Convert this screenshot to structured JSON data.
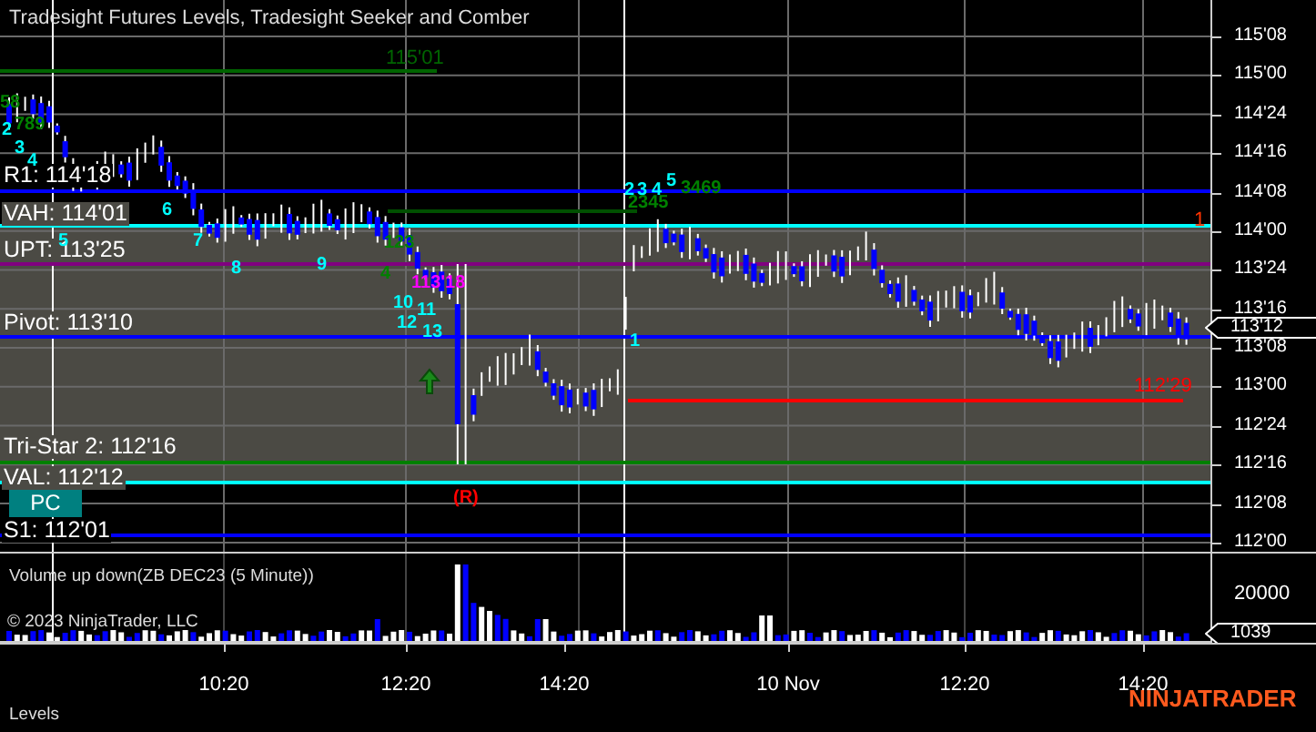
{
  "title": "Tradesight Futures Levels, Tradesight Seeker and Comber",
  "levels": [
    {
      "label": "R1: 114'18",
      "color": "#0000ff"
    },
    {
      "label": "VAH: 114'01",
      "color": "#00ffff"
    },
    {
      "label": "UPT: 113'25",
      "color": "#800080"
    },
    {
      "label": "Pivot: 113'10",
      "color": "#0000ff"
    },
    {
      "label": "Tri-Star 2: 112'16",
      "color": "#008000"
    },
    {
      "label": "VAL: 112'12",
      "color": "#00ffff"
    },
    {
      "label": "S1: 112'01",
      "color": "#0000ff"
    }
  ],
  "level_tags": [
    {
      "text": "115'01",
      "color": "#006400"
    },
    {
      "text": "112'29",
      "color": "#ff0000"
    },
    {
      "text": "1",
      "color": "#ff3300"
    }
  ],
  "markers": [
    {
      "text": "58",
      "color": "#008000"
    },
    {
      "text": "2",
      "color": "#00ffff"
    },
    {
      "text": "789",
      "color": "#008000"
    },
    {
      "text": "3",
      "color": "#00ffff"
    },
    {
      "text": "4",
      "color": "#00ffff"
    },
    {
      "text": "5",
      "color": "#00ffff"
    },
    {
      "text": "6",
      "color": "#00ffff"
    },
    {
      "text": "7",
      "color": "#00ffff"
    },
    {
      "text": "8",
      "color": "#00ffff"
    },
    {
      "text": "9",
      "color": "#00ffff"
    },
    {
      "text": "123",
      "color": "#008000"
    },
    {
      "text": "4",
      "color": "#008000"
    },
    {
      "text": "113'18",
      "color": "#ff00ff"
    },
    {
      "text": "10",
      "color": "#00ffff"
    },
    {
      "text": "11",
      "color": "#00ffff"
    },
    {
      "text": "12",
      "color": "#00ffff"
    },
    {
      "text": "13",
      "color": "#00ffff"
    },
    {
      "text": "(R)",
      "color": "#ff0000"
    },
    {
      "text": "1",
      "color": "#00ffff"
    },
    {
      "text": "2",
      "color": "#00ffff"
    },
    {
      "text": "3",
      "color": "#00ffff"
    },
    {
      "text": "4",
      "color": "#00ffff"
    },
    {
      "text": "5",
      "color": "#00ffff"
    },
    {
      "text": "3469",
      "color": "#008000"
    },
    {
      "text": "2345",
      "color": "#008000"
    }
  ],
  "badge": "PC",
  "price_axis": {
    "labels": [
      "115'08",
      "115'00",
      "114'24",
      "114'16",
      "114'08",
      "114'00",
      "113'24",
      "113'16",
      "113'08",
      "113'00",
      "112'24",
      "112'16",
      "112'08",
      "112'00"
    ],
    "current": "113'12"
  },
  "volume": {
    "title": "Volume up down(ZB DEC23 (5 Minute))",
    "copyright": "© 2023 NinjaTrader, LLC",
    "axis_label": "20000",
    "current": "1039"
  },
  "time_axis": [
    "10:20",
    "12:20",
    "14:20",
    "10 Nov",
    "12:20",
    "14:20"
  ],
  "footer": {
    "tab": "Levels",
    "logo": "NINJATRADER"
  }
}
